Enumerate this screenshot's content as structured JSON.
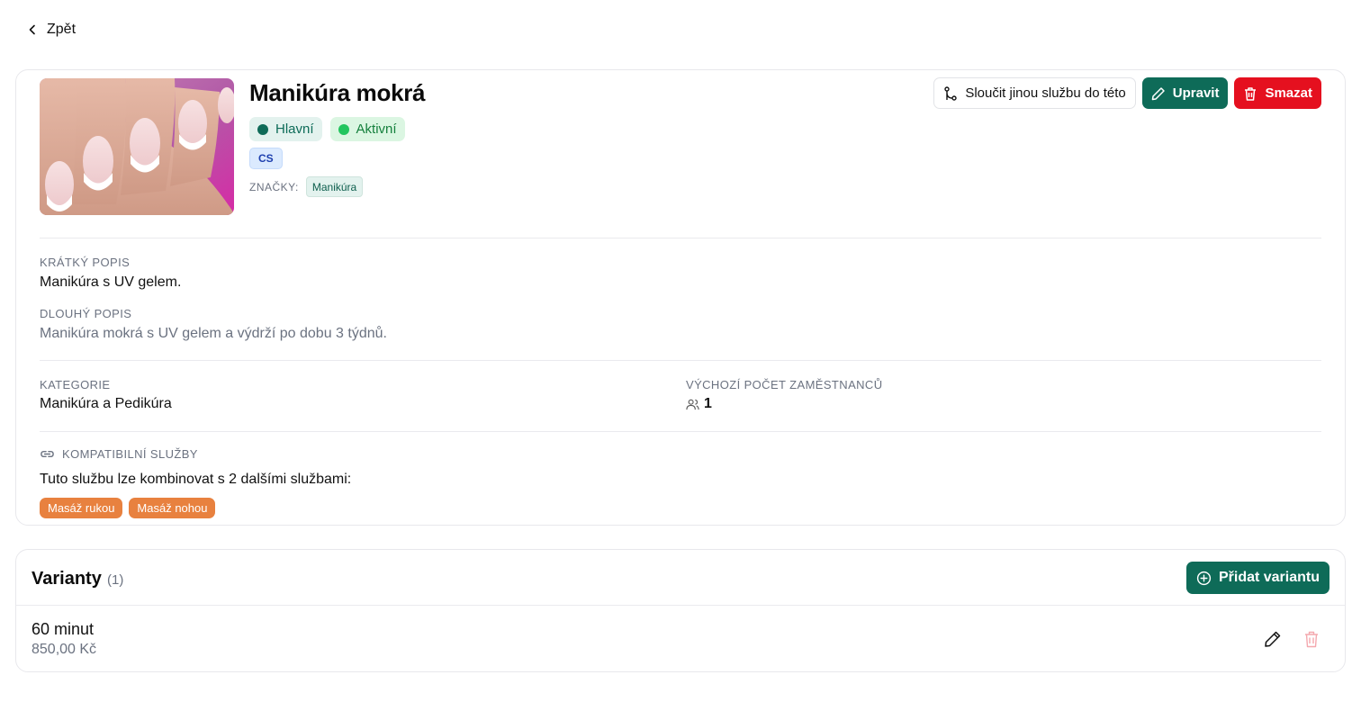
{
  "nav": {
    "back_label": "Zpět"
  },
  "service": {
    "title": "Manikúra mokrá",
    "badges": {
      "main": "Hlavní",
      "active": "Aktivní",
      "language": "CS"
    },
    "tags_label": "ZNAČKY:",
    "tags": [
      "Manikúra"
    ],
    "actions": {
      "merge": "Sloučit jinou službu do této",
      "edit": "Upravit",
      "delete": "Smazat"
    },
    "short_description": {
      "label": "KRÁTKÝ POPIS",
      "value": "Manikúra s UV gelem."
    },
    "long_description": {
      "label": "DLOUHÝ POPIS",
      "value": "Manikúra mokrá s UV gelem a výdrží po dobu 3 týdnů."
    },
    "category": {
      "label": "KATEGORIE",
      "value": "Manikúra a Pedikúra"
    },
    "default_staff": {
      "label": "VÝCHOZÍ POČET ZAMĚSTNANCŮ",
      "value": "1"
    },
    "compatible": {
      "label": "KOMPATIBILNÍ SLUŽBY",
      "text": "Tuto službu lze kombinovat s 2 dalšími službami:",
      "services": [
        "Masáž rukou",
        "Masáž nohou"
      ]
    }
  },
  "variants": {
    "title": "Varianty",
    "count": "(1)",
    "add_label": "Přidat variantu",
    "items": [
      {
        "name": "60 minut",
        "price": "850,00 Kč"
      }
    ]
  },
  "colors": {
    "primary": "#0e6b58",
    "danger": "#e5101f",
    "compatible_tag": "#e8813f",
    "active_dot": "#22c55e"
  },
  "icons": {
    "back": "chevron-left-icon",
    "merge": "git-merge-icon",
    "edit": "pencil-icon",
    "delete": "trash-icon",
    "staff": "users-icon",
    "compatible": "link-icon",
    "add": "plus-circle-icon"
  }
}
